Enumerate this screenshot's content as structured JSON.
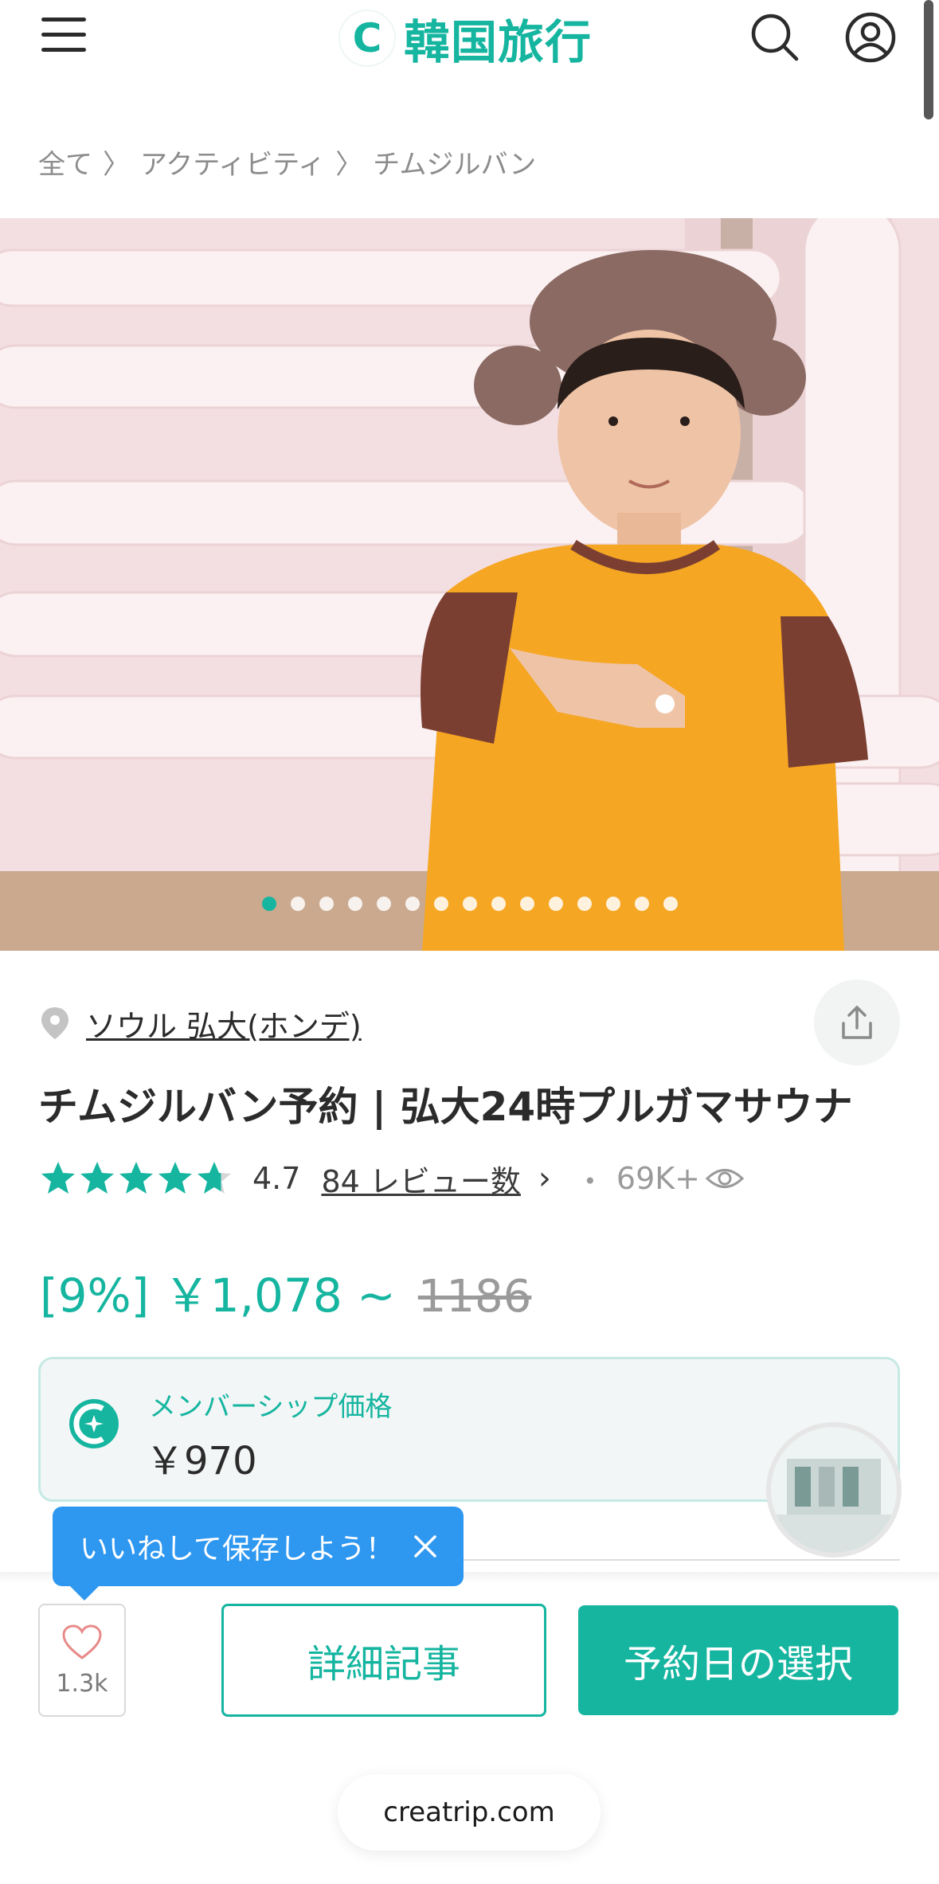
{
  "header": {
    "logo_mark": "C",
    "logo_text": "韓国旅行",
    "menu_icon": "hamburger-menu-icon",
    "search_icon": "search-icon",
    "account_icon": "user-account-icon"
  },
  "breadcrumb": {
    "items": [
      "全て",
      "アクティビティ",
      "チムジルバン"
    ],
    "separator": "〉"
  },
  "carousel": {
    "total_slides": 15,
    "active_index": 0
  },
  "product": {
    "location": "ソウル 弘大(ホンデ)",
    "title": "チムジルバン予約 | 弘大24時プルガマサウナ",
    "rating": "4.7",
    "stars_shown": 4.7,
    "reviews": "84 レビュー数",
    "views_separator": "・",
    "views": "69K+",
    "price": "[9%] ￥1,078 ~",
    "original_price": "1186"
  },
  "membership": {
    "label": "メンバーシップ価格",
    "price": "￥970"
  },
  "tooltip": {
    "text": "いいねして保存しよう！"
  },
  "bottom_bar": {
    "like_count": "1.3k",
    "detail_label": "詳細記事",
    "reserve_label": "予約日の選択"
  },
  "browser": {
    "url": "creatrip.com"
  },
  "colors": {
    "accent": "#15b5a0",
    "tooltip": "#2e97f0",
    "text": "#2b2b2b",
    "muted": "#8c8c8c"
  }
}
